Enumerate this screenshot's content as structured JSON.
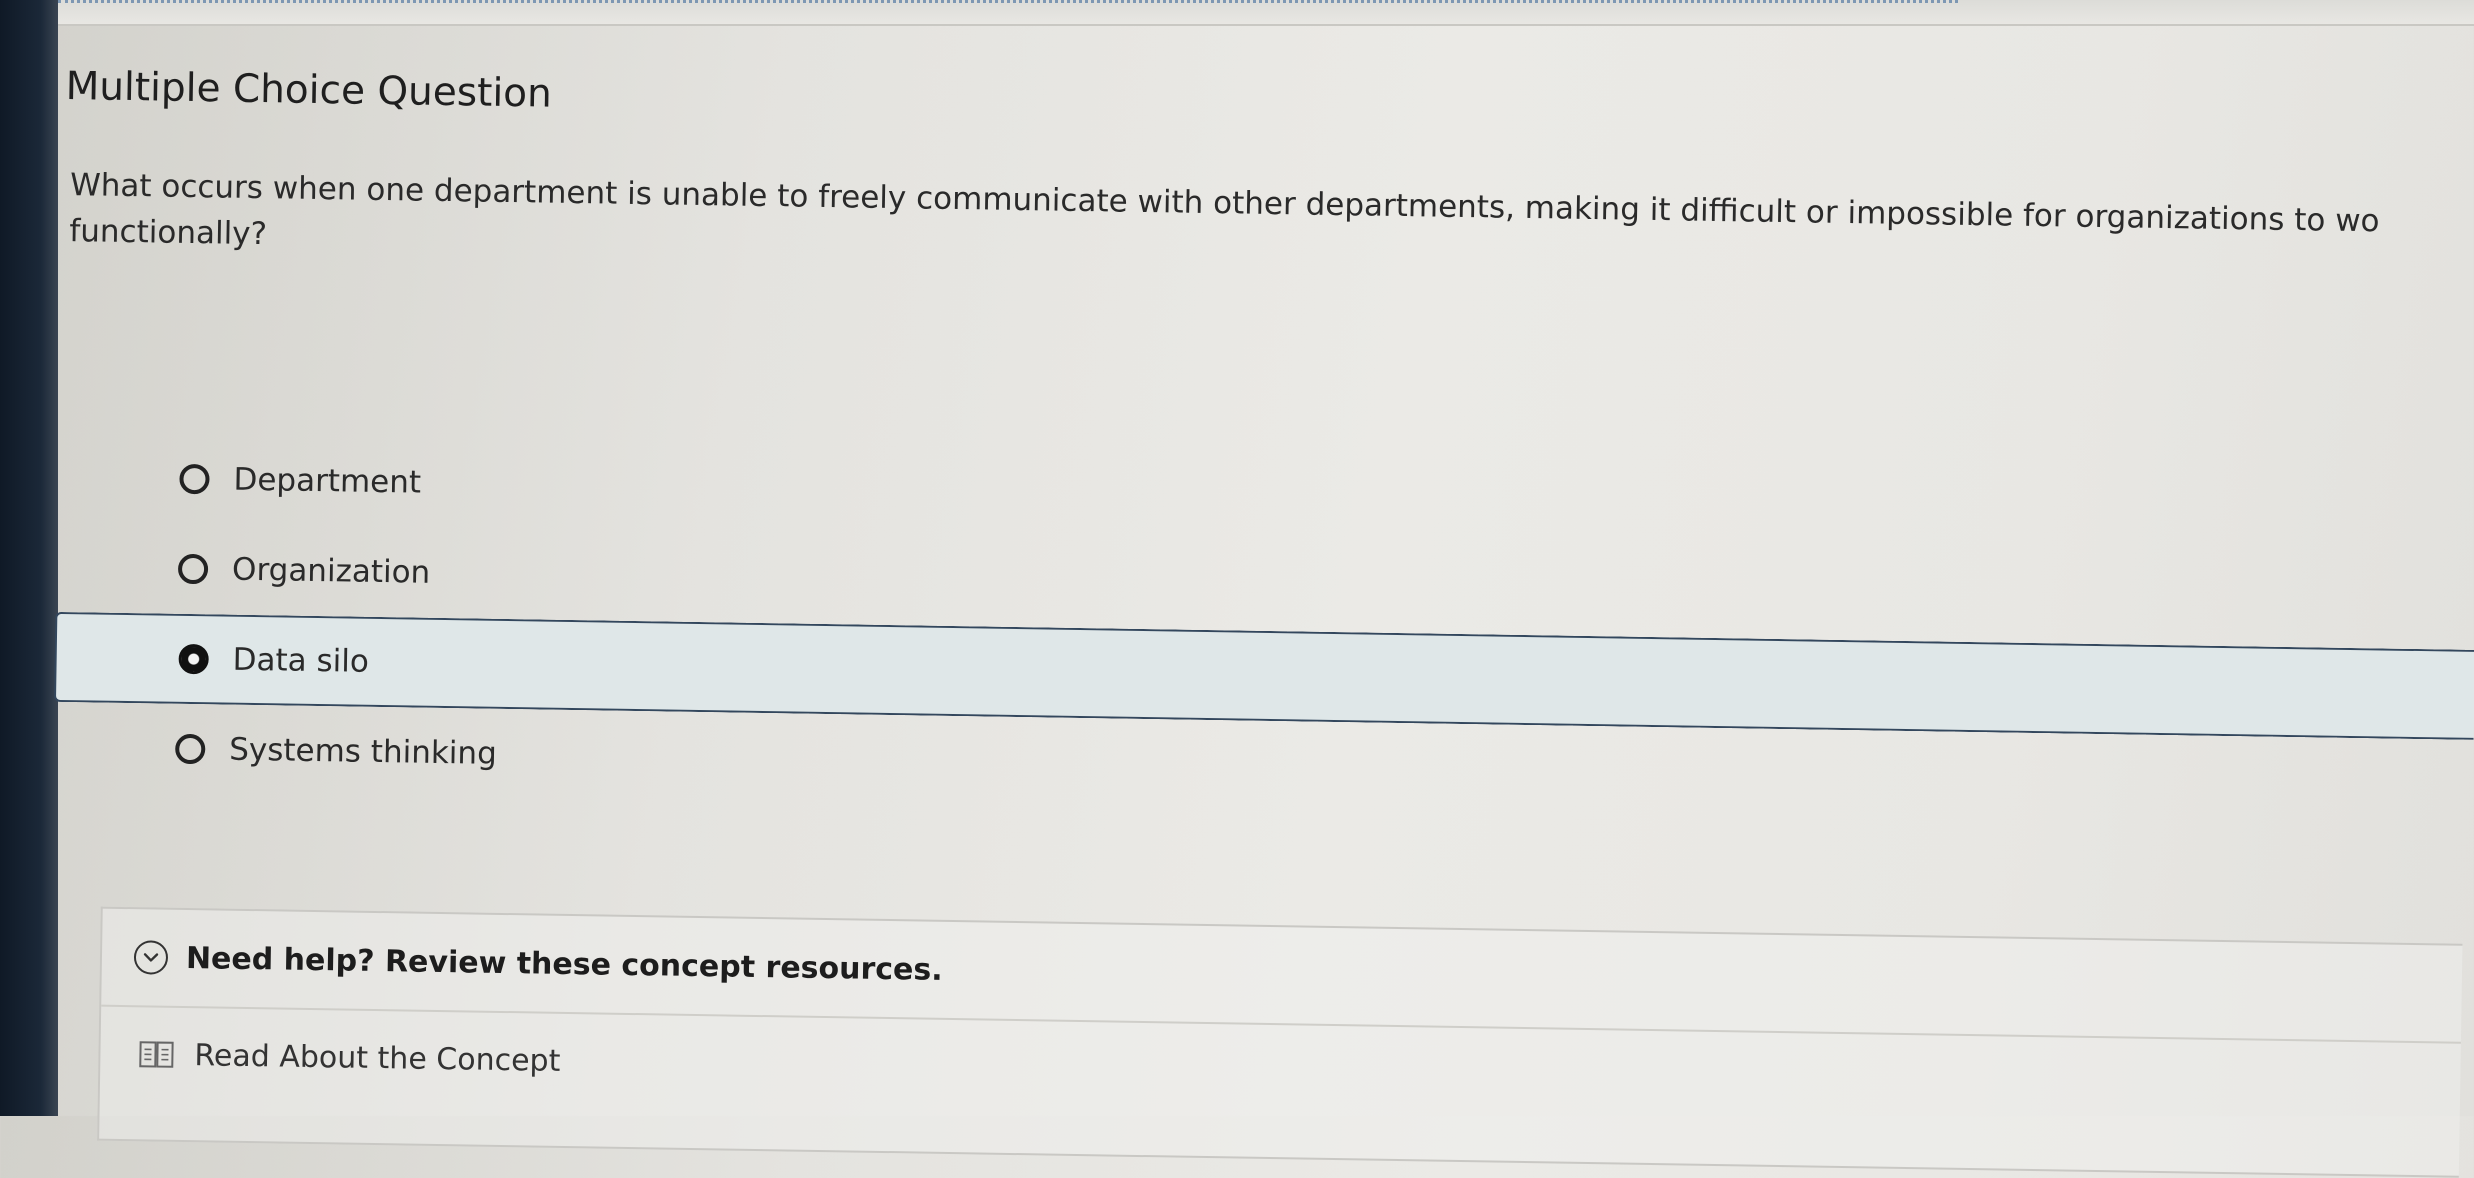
{
  "question": {
    "type_label": "Multiple Choice Question",
    "prompt": "What occurs when one department is unable to freely communicate with other departments, making it difficult or impossible for organizations to wo functionally?"
  },
  "options": [
    {
      "label": "Department",
      "selected": false
    },
    {
      "label": "Organization",
      "selected": false
    },
    {
      "label": "Data silo",
      "selected": true
    },
    {
      "label": "Systems thinking",
      "selected": false
    }
  ],
  "help": {
    "title": "Need help? Review these concept resources.",
    "link_label": "Read About the Concept"
  },
  "colors": {
    "selected_fill": "#dfe7e8",
    "selected_border": "#33475d",
    "left_edge": "#1b2838"
  }
}
